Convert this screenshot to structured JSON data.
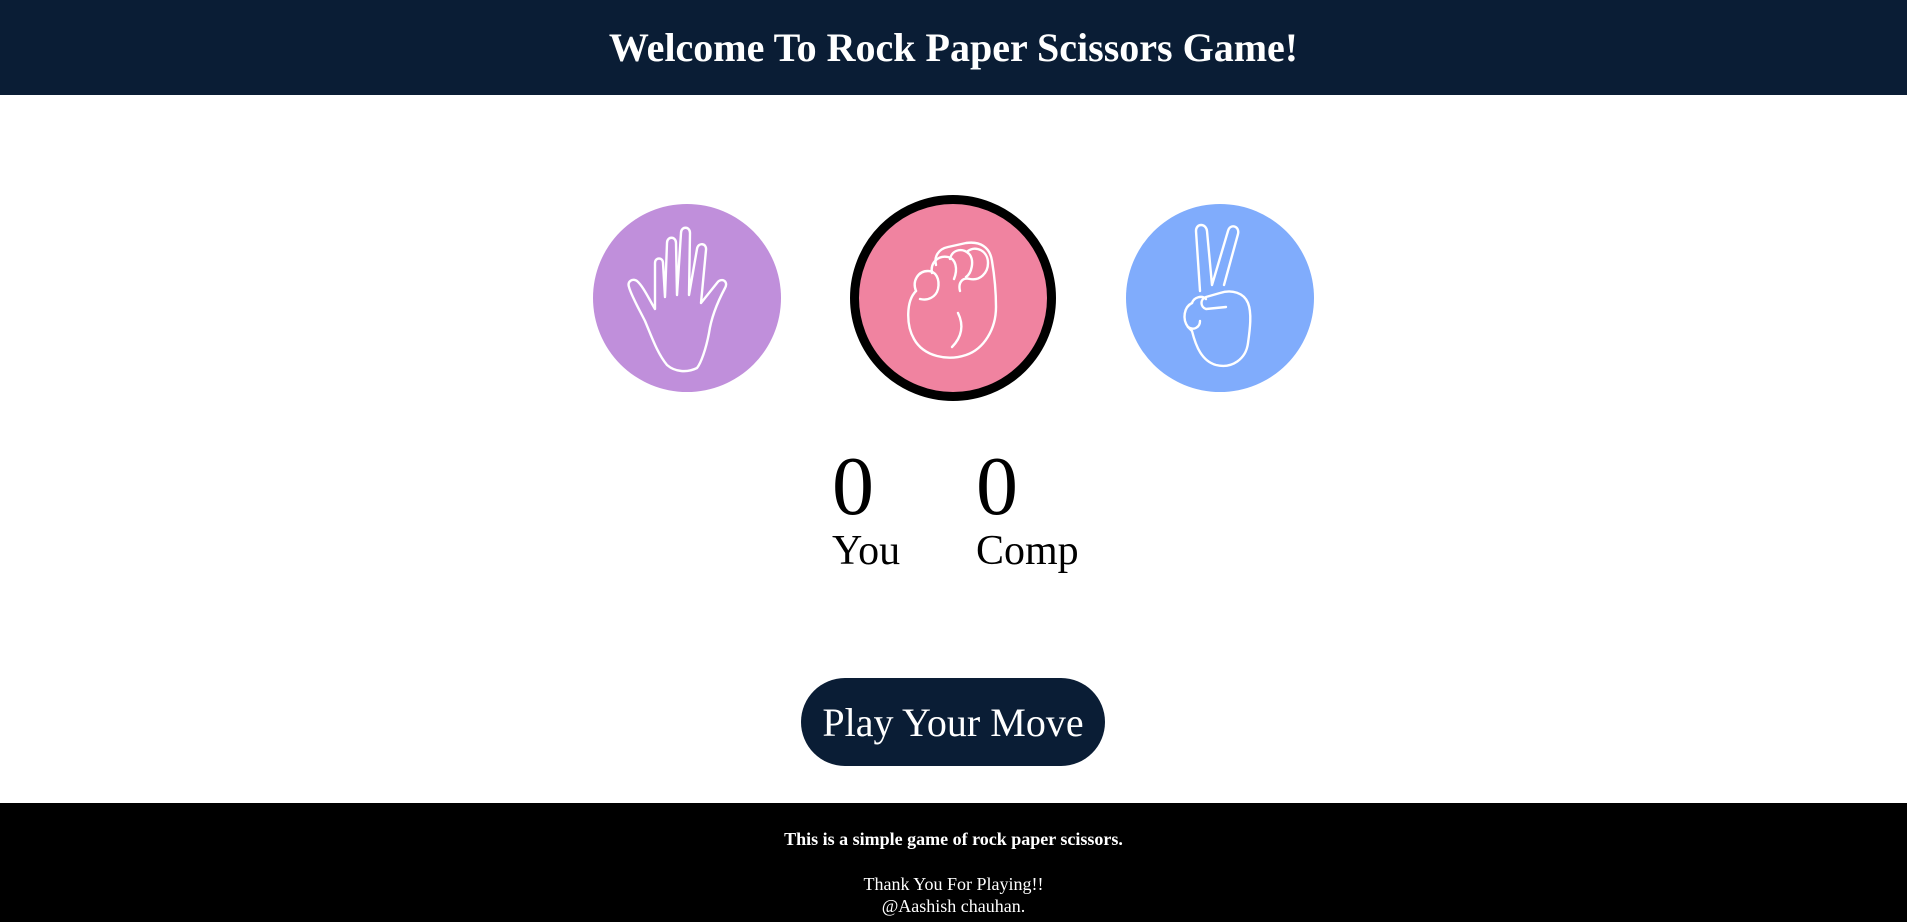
{
  "header": {
    "title": "Welcome To Rock Paper Scissors Game!",
    "bg_color": "#0a1d35"
  },
  "choices": [
    {
      "name": "paper",
      "icon": "open-hand-icon",
      "color": "#c08fdb",
      "selected": false
    },
    {
      "name": "rock",
      "icon": "fist-icon",
      "color": "#f083a0",
      "selected": true
    },
    {
      "name": "scissors",
      "icon": "peace-sign-icon",
      "color": "#80acfc",
      "selected": false
    }
  ],
  "scoreboard": {
    "user": {
      "score": "0",
      "label": "You"
    },
    "comp": {
      "score": "0",
      "label": "Comp"
    }
  },
  "play_button": {
    "label": "Play Your Move"
  },
  "footer": {
    "description": "This is a simple game of rock paper scissors.",
    "thanks": "Thank You For Playing!!",
    "author": "@Aashish chauhan."
  }
}
